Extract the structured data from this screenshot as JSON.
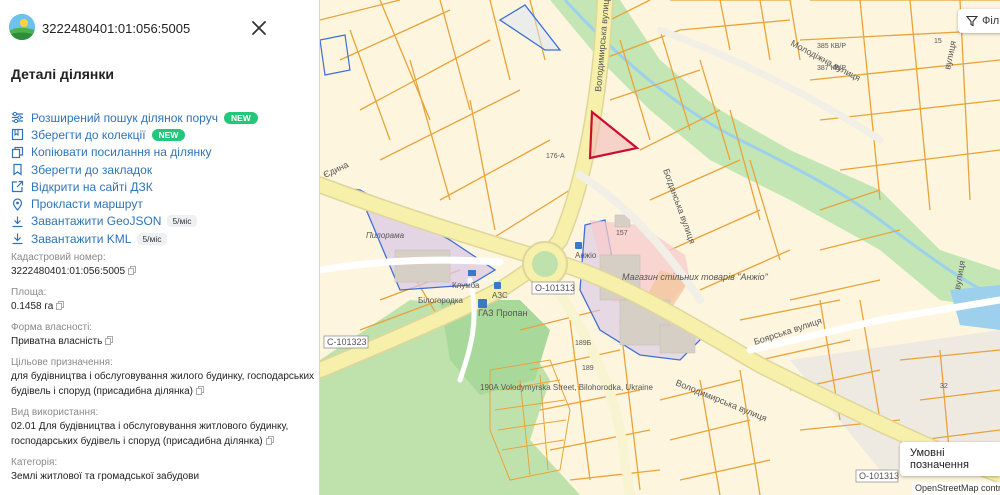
{
  "search": {
    "cadastral_number": "3222480401:01:056:5005"
  },
  "panel": {
    "title": "Деталі ділянки",
    "actions": [
      {
        "label": "Розширений пошук ділянок поруч",
        "badge": "NEW",
        "icon": "sliders-icon"
      },
      {
        "label": "Зберегти до колекції",
        "badge": "NEW",
        "icon": "bookmark-icon"
      },
      {
        "label": "Копіювати посилання на ділянку",
        "icon": "copy-icon"
      },
      {
        "label": "Зберегти до закладок",
        "icon": "bookmark-icon"
      },
      {
        "label": "Відкрити на сайті ДЗК",
        "icon": "external-link-icon"
      },
      {
        "label": "Прокласти маршрут",
        "icon": "map-pin-icon"
      },
      {
        "label": "Завантажити GeoJSON",
        "quota": "5/міс",
        "icon": "download-icon"
      },
      {
        "label": "Завантажити KML",
        "quota": "5/міс",
        "icon": "download-icon"
      }
    ],
    "fields": [
      {
        "label": "Кадастровий номер:",
        "value": "3222480401:01:056:5005"
      },
      {
        "label": "Площа:",
        "value": "0.1458 га"
      },
      {
        "label": "Форма власності:",
        "value": "Приватна власність"
      },
      {
        "label": "Цільове призначення:",
        "value": "для будівництва і обслуговування жилого будинку, господарських будівель і споруд (присадибна ділянка)"
      },
      {
        "label": "Вид використання:",
        "value": "02.01 Для будівництва і обслуговування житлового будинку, господарських будівель і споруд (присадибна ділянка)"
      },
      {
        "label": "Категорія:",
        "value": "Землі житлової та громадської забудови"
      }
    ]
  },
  "map": {
    "filter_label": "Філ",
    "legend_label": "Умовні позначення",
    "attribution": "OpenStreetMap contrib",
    "road_labels": {
      "volodymyrska_north": "Володимирська вулиця",
      "volodymyrska_south": "Володимирська вулиця",
      "bohdanska": "Богданська вулиця",
      "boiarska": "Боярська вулиця",
      "molodizhna": "Молодіжна вулиця",
      "yedyna": "Єдина",
      "vulytsia_ne": "вулиця",
      "vulytsia_e": "вулиця"
    },
    "route_labels": [
      "О-101313",
      "С-101323",
      "О-101313"
    ],
    "pois": {
      "shop": "Магазин стільних товарів \"Анжіо\"",
      "gas": "ГАЗ Пропан",
      "azs": "АЗС",
      "pylorama": "Пилорама",
      "klumba": "Клумба",
      "bilohorodka": "Білогородка",
      "anzhio": "Анжіо",
      "address": "190А Volodymyrska Street, Bilohorodka, Ukraine"
    },
    "house_numbers": [
      "157",
      "176-А",
      "189Б",
      "189",
      "15",
      "32",
      "385 КВ/Р",
      "387 КВ/Р"
    ],
    "colors": {
      "accent": "#2f73b8",
      "badge": "#22c77a",
      "parcel_outline": "#e8a33a",
      "selected_parcel": "#c8102e",
      "road": "#f4eea0"
    }
  }
}
